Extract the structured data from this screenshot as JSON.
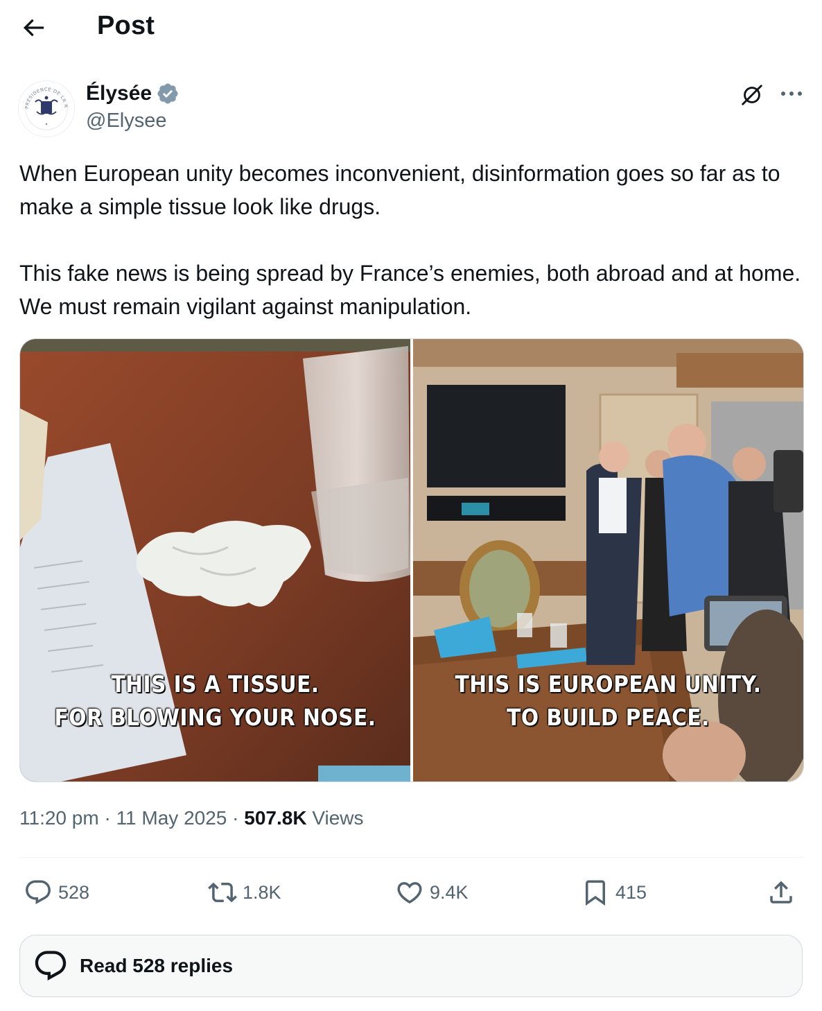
{
  "header": {
    "title": "Post",
    "back_icon": "arrow-left-icon"
  },
  "author": {
    "name": "Élysée",
    "handle": "@Elysee",
    "verified": true,
    "verified_color": "#829aab",
    "avatar_icon": "presidence-seal-icon",
    "avatar_text": "PRÉSIDENCE DE LA RÉPUBLIQUE"
  },
  "post": {
    "paragraphs": [
      "When European unity becomes inconvenient, disinformation goes so far as to make a simple tissue look like drugs.",
      "This fake news is being spread by France’s enemies, both abroad and at home. We must remain vigilant against manipulation."
    ],
    "images": [
      {
        "caption_line1": "THIS IS A TISSUE.",
        "caption_line2": "FOR BLOWING YOUR NOSE."
      },
      {
        "caption_line1": "THIS IS EUROPEAN UNITY.",
        "caption_line2": "TO BUILD PEACE."
      }
    ],
    "time": "11:20 pm",
    "separator": "·",
    "date": "11 May 2025",
    "views_count": "507.8K",
    "views_label": "Views"
  },
  "actions": {
    "replies": "528",
    "reposts": "1.8K",
    "likes": "9.4K",
    "bookmarks": "415"
  },
  "read_replies": {
    "label": "Read 528 replies"
  },
  "colors": {
    "text": "#0f1419",
    "secondary": "#536471",
    "border": "#cfd9de"
  }
}
